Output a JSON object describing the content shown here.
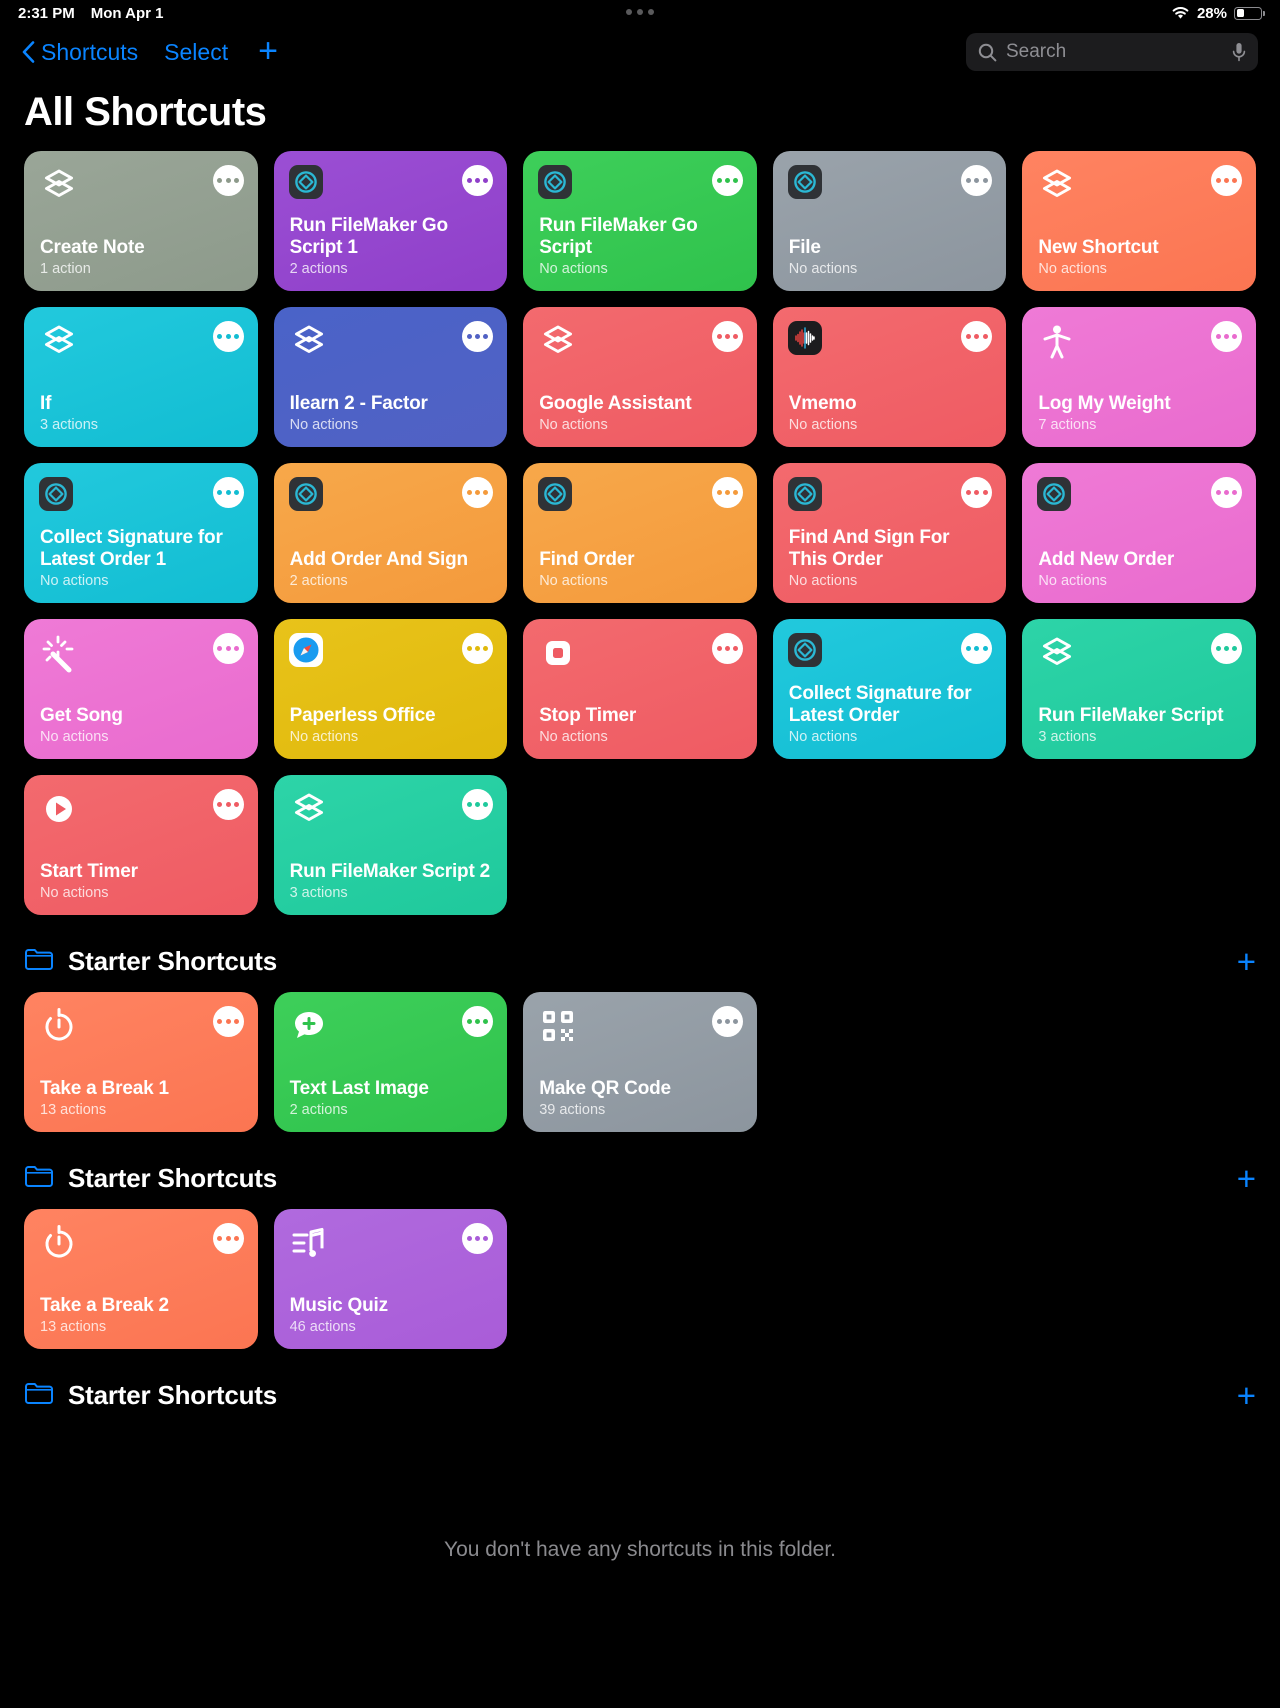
{
  "status_bar": {
    "time": "2:31 PM",
    "date": "Mon Apr 1",
    "battery_percent": "28%",
    "wifi_icon": "wifi-icon",
    "battery_icon": "battery-icon"
  },
  "nav": {
    "back_label": "Shortcuts",
    "select_label": "Select",
    "add_label": "+",
    "back_icon": "chevron-left-icon",
    "accent": "#0a84ff"
  },
  "search": {
    "placeholder": "Search",
    "value": "",
    "search_icon": "search-icon",
    "mic_icon": "microphone-icon"
  },
  "page": {
    "title": "All Shortcuts"
  },
  "shortcuts": [
    {
      "name": "Create Note",
      "sub": "1 action",
      "bg1": "#9aa698",
      "bg2": "#8d9a8b",
      "icon": "shortcuts-layers-icon",
      "dot": "#8d9a8b"
    },
    {
      "name": "Run FileMaker Go Script 1",
      "sub": "2 actions",
      "bg1": "#9b4fd4",
      "bg2": "#8f3fc9",
      "icon": "filemaker-app-icon",
      "dot": "#8f3fc9"
    },
    {
      "name": "Run FileMaker Go Script",
      "sub": "No actions",
      "bg1": "#3ecf5a",
      "bg2": "#2fc24c",
      "icon": "filemaker-app-icon",
      "dot": "#2fc24c"
    },
    {
      "name": "File",
      "sub": "No actions",
      "bg1": "#9aa3ab",
      "bg2": "#8c959e",
      "icon": "filemaker-app-icon",
      "dot": "#8c959e"
    },
    {
      "name": "New Shortcut",
      "sub": "No actions",
      "bg1": "#ff8361",
      "bg2": "#fb7552",
      "icon": "shortcuts-layers-icon",
      "dot": "#fb7552"
    },
    {
      "name": "If",
      "sub": "3 actions",
      "bg1": "#22c9dd",
      "bg2": "#12bdd2",
      "icon": "shortcuts-layers-icon",
      "dot": "#12bdd2"
    },
    {
      "name": "Ilearn 2 - Factor",
      "sub": "No actions",
      "bg1": "#4a63c8",
      "bg2": "#5161c4",
      "icon": "shortcuts-layers-icon",
      "dot": "#5161c4"
    },
    {
      "name": "Google Assistant",
      "sub": "No actions",
      "bg1": "#f36a6e",
      "bg2": "#ef5b63",
      "icon": "shortcuts-layers-icon",
      "dot": "#ef5b63"
    },
    {
      "name": "Vmemo",
      "sub": "No actions",
      "bg1": "#f36a6e",
      "bg2": "#ef5b63",
      "icon": "voice-memo-app-icon",
      "dot": "#ef5b63"
    },
    {
      "name": "Log My Weight",
      "sub": "7 actions",
      "bg1": "#ef7ad6",
      "bg2": "#e96bce",
      "icon": "person-figure-icon",
      "dot": "#e96bce"
    },
    {
      "name": "Collect Signature for Latest Order 1",
      "sub": "No actions",
      "bg1": "#22c9dd",
      "bg2": "#12bdd2",
      "icon": "filemaker-app-icon",
      "dot": "#12bdd2"
    },
    {
      "name": "Add Order And Sign",
      "sub": "2 actions",
      "bg1": "#f7a84a",
      "bg2": "#f49a3c",
      "icon": "filemaker-app-icon",
      "dot": "#f49a3c"
    },
    {
      "name": "Find Order",
      "sub": "No actions",
      "bg1": "#f7a84a",
      "bg2": "#f49a3c",
      "icon": "filemaker-app-icon",
      "dot": "#f49a3c"
    },
    {
      "name": "Find And Sign For This Order",
      "sub": "No actions",
      "bg1": "#f36a6e",
      "bg2": "#ef5b63",
      "icon": "filemaker-app-icon",
      "dot": "#ef5b63"
    },
    {
      "name": "Add New Order",
      "sub": "No actions",
      "bg1": "#ef7ad6",
      "bg2": "#e96bce",
      "icon": "filemaker-app-icon",
      "dot": "#e96bce"
    },
    {
      "name": "Get Song",
      "sub": "No actions",
      "bg1": "#ef7ad6",
      "bg2": "#e96bce",
      "icon": "magic-wand-icon",
      "dot": "#e96bce"
    },
    {
      "name": "Paperless Office",
      "sub": "No actions",
      "bg1": "#e8c31a",
      "bg2": "#e0b90c",
      "icon": "safari-app-icon",
      "dot": "#e0b90c"
    },
    {
      "name": "Stop Timer",
      "sub": "No actions",
      "bg1": "#f36a6e",
      "bg2": "#ef5b63",
      "icon": "stop-square-icon",
      "dot": "#ef5b63"
    },
    {
      "name": "Collect Signature for Latest Order",
      "sub": "No actions",
      "bg1": "#22c9dd",
      "bg2": "#12bdd2",
      "icon": "filemaker-app-icon",
      "dot": "#12bdd2"
    },
    {
      "name": "Run FileMaker Script",
      "sub": "3 actions",
      "bg1": "#2dd4a8",
      "bg2": "#1fc99c",
      "icon": "shortcuts-layers-icon",
      "dot": "#1fc99c"
    },
    {
      "name": "Start Timer",
      "sub": "No actions",
      "bg1": "#f36a6e",
      "bg2": "#ef5b63",
      "icon": "play-circle-icon",
      "dot": "#ef5b63"
    },
    {
      "name": "Run FileMaker Script 2",
      "sub": "3 actions",
      "bg1": "#2dd4a8",
      "bg2": "#1fc99c",
      "icon": "shortcuts-layers-icon",
      "dot": "#1fc99c"
    }
  ],
  "folders": [
    {
      "title": "Starter Shortcuts",
      "folder_icon": "folder-icon",
      "add_label": "+",
      "empty_message": "",
      "shortcuts": [
        {
          "name": "Take a Break 1",
          "sub": "13 actions",
          "bg1": "#ff8361",
          "bg2": "#fb7552",
          "icon": "timer-icon",
          "dot": "#fb7552"
        },
        {
          "name": "Text Last Image",
          "sub": "2 actions",
          "bg1": "#3ecf5a",
          "bg2": "#2fc24c",
          "icon": "message-plus-icon",
          "dot": "#2fc24c"
        },
        {
          "name": "Make QR Code",
          "sub": "39 actions",
          "bg1": "#9aa3ab",
          "bg2": "#8c959e",
          "icon": "qr-code-icon",
          "dot": "#8c959e"
        }
      ]
    },
    {
      "title": "Starter Shortcuts",
      "folder_icon": "folder-icon",
      "add_label": "+",
      "empty_message": "",
      "shortcuts": [
        {
          "name": "Take a Break 2",
          "sub": "13 actions",
          "bg1": "#ff8361",
          "bg2": "#fb7552",
          "icon": "timer-icon",
          "dot": "#fb7552"
        },
        {
          "name": "Music Quiz",
          "sub": "46 actions",
          "bg1": "#b06ade",
          "bg2": "#a95cd8",
          "icon": "music-list-icon",
          "dot": "#a95cd8"
        }
      ]
    },
    {
      "title": "Starter Shortcuts",
      "folder_icon": "folder-icon",
      "add_label": "+",
      "empty_message": "You don't have any shortcuts in this folder.",
      "shortcuts": []
    }
  ]
}
